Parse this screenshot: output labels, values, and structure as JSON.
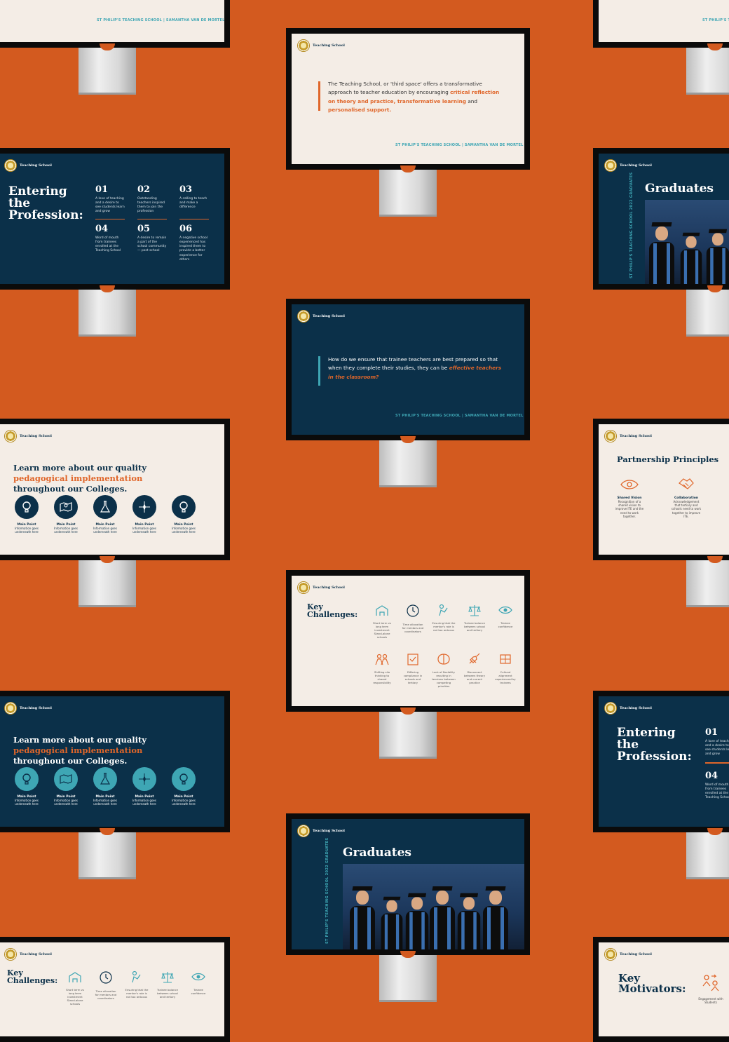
{
  "colors": {
    "background": "#D35A1F",
    "navy": "#0B3049",
    "cream": "#F4EDE6",
    "accent_orange": "#E0662A",
    "accent_teal": "#3EA6B4"
  },
  "brand": {
    "logo_text": "Teaching School"
  },
  "footer": "ST PHILIP'S TEACHING SCHOOL  |  SAMANTHA VAN DE MORTEL",
  "quote_slide": {
    "text_plain": "The Teaching School, or 'third space' offers a transformative approach to teacher education by encouraging ",
    "text_highlight_1": "critical reflection on theory and practice, transformative learning",
    "text_mid": " and ",
    "text_highlight_2": "personalised support."
  },
  "question_slide": {
    "text_plain": "How do we ensure that trainee teachers are best prepared so that when they complete their studies, they can be ",
    "text_highlight": "effective teachers in the classroom?"
  },
  "entering_slide": {
    "title": "Entering the Profession:",
    "items": [
      {
        "num": "01",
        "text": "A love of teaching and a desire to see students learn and grow"
      },
      {
        "num": "02",
        "text": "Outstanding teachers inspired them to join the profession"
      },
      {
        "num": "03",
        "text": "A calling to teach and make a difference"
      },
      {
        "num": "04",
        "text": "Word of mouth from trainees enrolled at the Teaching School"
      },
      {
        "num": "05",
        "text": "A desire to remain a part of the school community — post school"
      },
      {
        "num": "06",
        "text": "A negative school experienced has inspired them to provide a better experience for others"
      }
    ]
  },
  "graduates_slide": {
    "title": "Graduates",
    "side_text": "ST PHILIP'S TEACHING SCHOOL 2022 GRADUATES"
  },
  "learn_slide": {
    "title_1": "Learn more about our quality ",
    "title_highlight": "pedagogical implementation",
    "title_2": " throughout our Colleges.",
    "point_label": "Main Point",
    "point_sub": "Information goes underneath here",
    "icons": [
      "lightbulb-icon",
      "map-icon",
      "flask-icon",
      "compass-icon",
      "lightbulb-icon"
    ]
  },
  "partnership_slide": {
    "title": "Partnership Principles",
    "items": [
      {
        "label": "Shared Vision",
        "text": "Recognition of a shared vision to improve ITE and the need to work together."
      },
      {
        "label": "Collaboration",
        "text": "Acknowledgement that tertiary and schools need to work together to improve ITE."
      }
    ]
  },
  "challenges_slide": {
    "title": "Key Challenges:",
    "row1": [
      "Short term vs long term investment Stand-alone schools",
      "Time allocation for mentors and coordinators",
      "Ensuring that the mentor's role is not too arduous",
      "Trainee balance between school and tertiary",
      "Trainee confidence"
    ],
    "row2": [
      "Shifting silo thinking to shared responsibility",
      "Differing compliance in schools and tertiary",
      "Lack of flexibility resulting in tensions between competing priorities",
      "Disconnect between theory and current practice",
      "Cultural alignment experienced by trainees"
    ]
  },
  "motivators_slide": {
    "title": "Key Motivators:",
    "item": "Engagement with Students"
  }
}
